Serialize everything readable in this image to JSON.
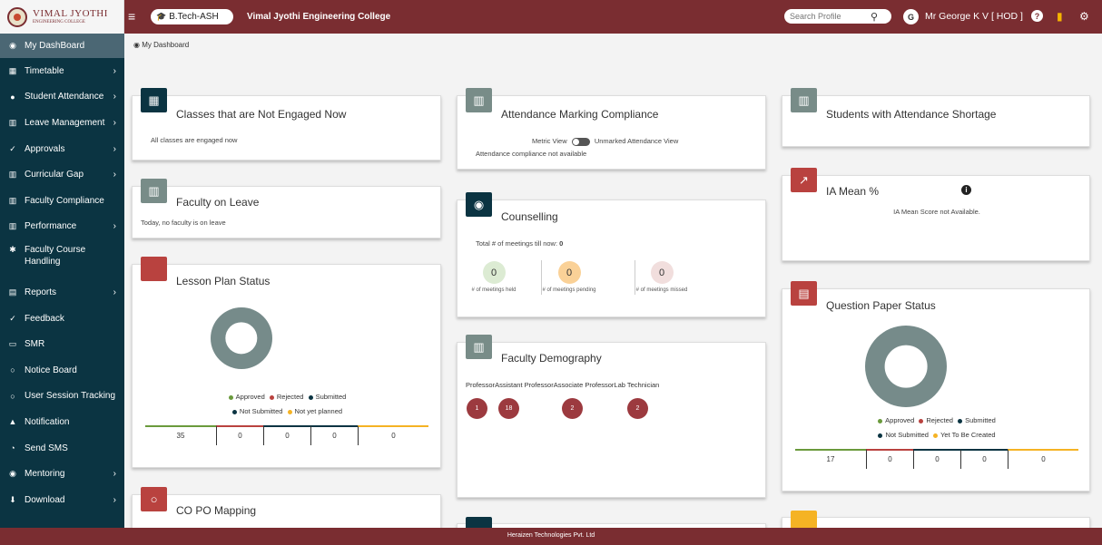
{
  "header": {
    "logo_text": "VIMAL JYOTHI",
    "logo_sub": "ENGINEERING COLLEGE",
    "course": "B.Tech-ASH",
    "college": "Vimal Jyothi Engineering College",
    "search_placeholder": "Search Profile",
    "avatar_initial": "G",
    "user": "Mr George K V [ HOD ]"
  },
  "sidebar": {
    "items": [
      {
        "label": "My DashBoard"
      },
      {
        "label": "Timetable"
      },
      {
        "label": "Student Attendance"
      },
      {
        "label": "Leave Management"
      },
      {
        "label": "Approvals"
      },
      {
        "label": "Curricular Gap"
      },
      {
        "label": "Faculty Compliance"
      },
      {
        "label": "Performance"
      },
      {
        "label": "Faculty Course Handling"
      },
      {
        "label": "Reports"
      },
      {
        "label": "Feedback"
      },
      {
        "label": "SMR"
      },
      {
        "label": "Notice Board"
      },
      {
        "label": "User Session Tracking"
      },
      {
        "label": "Notification"
      },
      {
        "label": "Send SMS"
      },
      {
        "label": "Mentoring"
      },
      {
        "label": "Download"
      }
    ]
  },
  "breadcrumb": "My Dashboard",
  "cards": {
    "classes": {
      "title": "Classes that are Not Engaged Now",
      "text": "All classes are engaged now"
    },
    "faculty_leave": {
      "title": "Faculty on Leave",
      "text": "Today, no faculty is on leave"
    },
    "lesson_plan": {
      "title": "Lesson Plan Status",
      "legend": [
        "Approved",
        "Rejected",
        "Submitted",
        "Not Submitted",
        "Not yet planned"
      ],
      "values": [
        "35",
        "0",
        "0",
        "0",
        "0"
      ]
    },
    "copo": {
      "title": "CO PO Mapping"
    },
    "attendance": {
      "title": "Attendance Marking Compliance",
      "metric": "Metric View",
      "unmarked": "Unmarked Attendance View",
      "text": "Attendance compliance not available"
    },
    "counselling": {
      "title": "Counselling",
      "total_label": "Total # of meetings till now:",
      "total": "0",
      "held": "0",
      "held_label": "# of meetings held",
      "pending": "0",
      "pending_label": "# of meetings pending",
      "missed": "0",
      "missed_label": "# of meetings missed"
    },
    "demography": {
      "title": "Faculty Demography",
      "labels": [
        "Professor",
        "Assistant Professor",
        "Associate Professor",
        "Lab Technician"
      ],
      "values": [
        "1",
        "18",
        "2",
        "2"
      ]
    },
    "shortage": {
      "title": "Students with Attendance Shortage"
    },
    "ia_mean": {
      "title": "IA Mean %",
      "text": "IA Mean Score not Available."
    },
    "qpaper": {
      "title": "Question Paper Status",
      "legend": [
        "Approved",
        "Rejected",
        "Submitted",
        "Not Submitted",
        "Yet To Be Created"
      ],
      "values": [
        "17",
        "0",
        "0",
        "0",
        "0"
      ]
    }
  },
  "footer": "Heraizen Technologies Pvt. Ltd",
  "colors": {
    "brand": "#7a2d31",
    "sidebar": "#0b3442",
    "approved": "#6a9a3c",
    "rejected": "#b9423f",
    "submitted": "#0b3442",
    "not_submitted": "#0b3442",
    "pending": "#f5b324"
  }
}
